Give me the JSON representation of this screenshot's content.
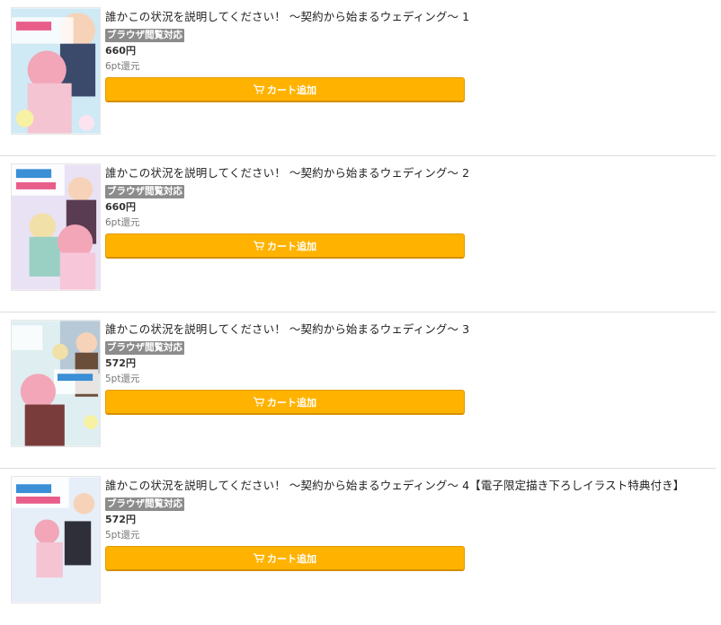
{
  "items": [
    {
      "title": "誰かこの状況を説明してください！ ～契約から始まるウェディング～ 1",
      "badge": "ブラウザ閲覧対応",
      "price": "660円",
      "points": "6pt還元",
      "cart_label": "カート追加",
      "cover_icon": "book-cover-image"
    },
    {
      "title": "誰かこの状況を説明してください！ ～契約から始まるウェディング～ 2",
      "badge": "ブラウザ閲覧対応",
      "price": "660円",
      "points": "6pt還元",
      "cart_label": "カート追加",
      "cover_icon": "book-cover-image"
    },
    {
      "title": "誰かこの状況を説明してください！ ～契約から始まるウェディング～ 3",
      "badge": "ブラウザ閲覧対応",
      "price": "572円",
      "points": "5pt還元",
      "cart_label": "カート追加",
      "cover_icon": "book-cover-image"
    },
    {
      "title": "誰かこの状況を説明してください！ ～契約から始まるウェディング～ 4【電子限定描き下ろしイラスト特典付き】",
      "badge": "ブラウザ閲覧対応",
      "price": "572円",
      "points": "5pt還元",
      "cart_label": "カート追加",
      "cover_icon": "book-cover-image"
    }
  ],
  "colors": {
    "cart_button": "#ffb300",
    "badge_bg": "#8c8c8c",
    "divider": "#dddddd"
  }
}
